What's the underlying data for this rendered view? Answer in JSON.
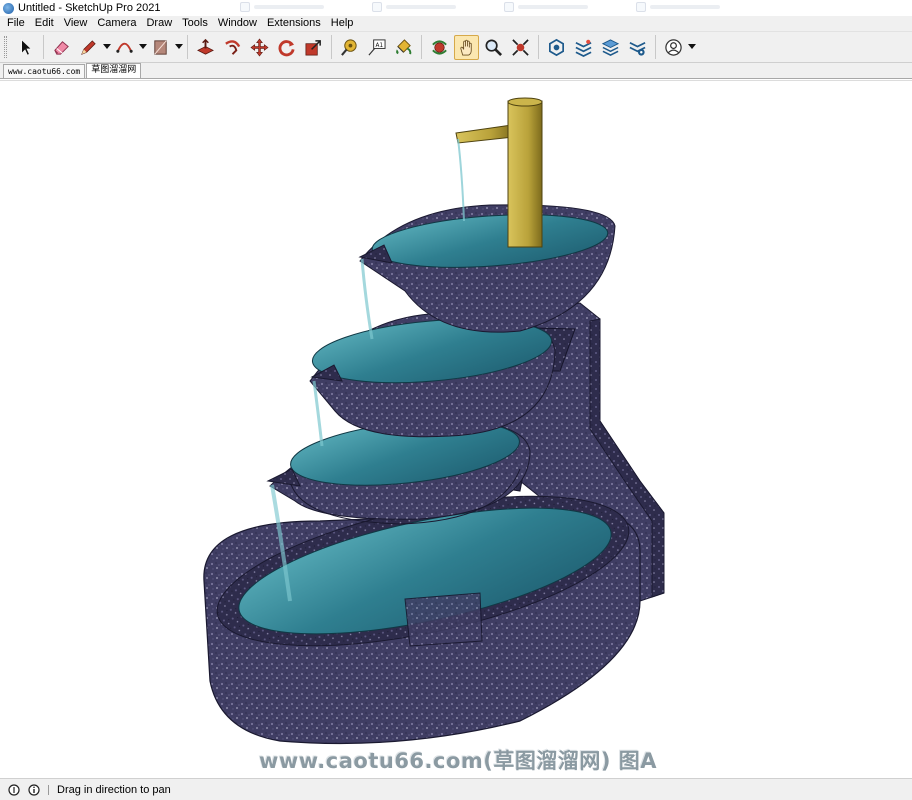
{
  "window": {
    "title": "Untitled - SketchUp Pro 2021"
  },
  "menu": {
    "items": [
      "File",
      "Edit",
      "View",
      "Camera",
      "Draw",
      "Tools",
      "Window",
      "Extensions",
      "Help"
    ]
  },
  "toolbar": {
    "tools": [
      {
        "icon": "select-arrow-icon"
      },
      {
        "icon": "eraser-icon"
      },
      {
        "icon": "pencil-line-icon"
      },
      {
        "icon": "arc-icon"
      },
      {
        "icon": "rectangle-icon"
      },
      {
        "icon": "push-pull-icon"
      },
      {
        "icon": "follow-me-icon"
      },
      {
        "icon": "move-icon"
      },
      {
        "icon": "rotate-icon"
      },
      {
        "icon": "scale-icon"
      },
      {
        "icon": "tape-measure-icon"
      },
      {
        "icon": "text-label-icon"
      },
      {
        "icon": "paint-bucket-icon"
      },
      {
        "icon": "orbit-icon"
      },
      {
        "icon": "pan-hand-icon"
      },
      {
        "icon": "zoom-icon"
      },
      {
        "icon": "zoom-extents-icon"
      },
      {
        "icon": "3d-warehouse-icon"
      },
      {
        "icon": "extension-warehouse-icon"
      },
      {
        "icon": "layout-icon"
      },
      {
        "icon": "extension-manager-icon"
      },
      {
        "icon": "account-icon"
      }
    ],
    "active_tool": "pan-hand-icon"
  },
  "scene_tabs": [
    {
      "label": "www.caotu66.com"
    },
    {
      "label": "草图溜溜网"
    }
  ],
  "viewport": {
    "watermark": "www.caotu66.com(草图溜溜网) 图A"
  },
  "statusbar": {
    "hint": "Drag in direction to pan"
  },
  "colors": {
    "stone": "#3f3d63",
    "water": "#2f7f90",
    "bamboo": "#b9a23a",
    "active_tool_bg": "#fbe7b0"
  }
}
